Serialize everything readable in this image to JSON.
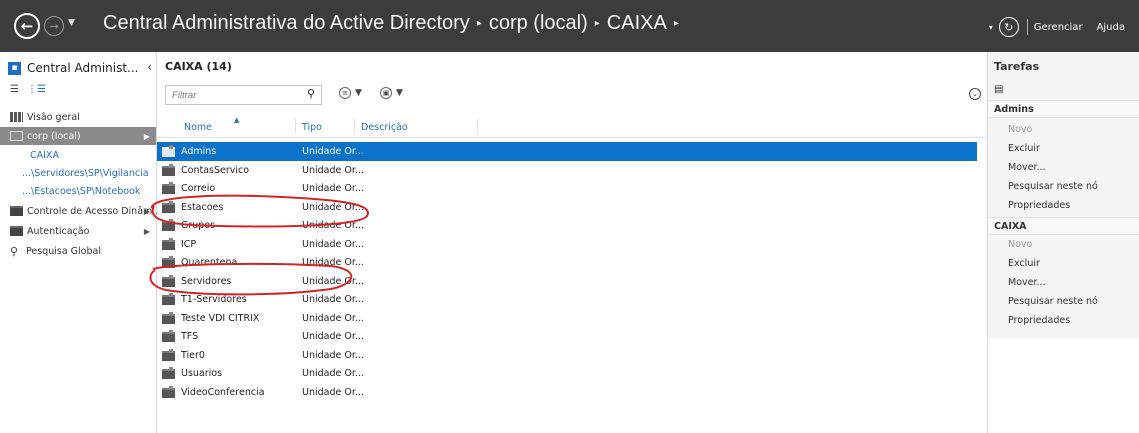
{
  "topbar": {
    "breadcrumbs": [
      "Central Administrativa do Active Directory",
      "corp (local)",
      "CAIXA"
    ],
    "separator": "▸",
    "manage": "Gerenciar",
    "help": "Ajuda"
  },
  "leftnav": {
    "title": "Central Administ...",
    "items": {
      "overview": "Visão geral",
      "corp": "corp (local)",
      "caixa": "CAIXA",
      "vigilancia": "...\\Servidores\\SP\\Vigilancia",
      "notebook": "...\\Estacoes\\SP\\Notebook",
      "access_control": "Controle de Acesso Dinâm...",
      "auth": "Autenticação",
      "global_search": "Pesquisa Global"
    }
  },
  "center": {
    "title": "CAIXA  (14)",
    "filter_placeholder": "Filtrar",
    "columns": [
      "Nome",
      "Tipo",
      "Descrição"
    ],
    "rows": [
      {
        "name": "Admins",
        "type": "Unidade Or..."
      },
      {
        "name": "ContasServico",
        "type": "Unidade Or..."
      },
      {
        "name": "Correio",
        "type": "Unidade Or..."
      },
      {
        "name": "Estacoes",
        "type": "Unidade Or..."
      },
      {
        "name": "Grupos",
        "type": "Unidade Or..."
      },
      {
        "name": "ICP",
        "type": "Unidade Or..."
      },
      {
        "name": "Quarentena",
        "type": "Unidade Or..."
      },
      {
        "name": "Servidores",
        "type": "Unidade Or..."
      },
      {
        "name": "T1-Servidores",
        "type": "Unidade Or..."
      },
      {
        "name": "Teste VDI CITRIX",
        "type": "Unidade Or..."
      },
      {
        "name": "TFS",
        "type": "Unidade Or..."
      },
      {
        "name": "Tier0",
        "type": "Unidade Or..."
      },
      {
        "name": "Usuarios",
        "type": "Unidade Or..."
      },
      {
        "name": "VideoConferencia",
        "type": "Unidade Or..."
      }
    ]
  },
  "tasks": {
    "title": "Tarefas",
    "section1": "Admins",
    "section1_actions": [
      "Novo",
      "Excluir",
      "Mover...",
      "Pesquisar neste nó",
      "Propriedades"
    ],
    "section2": "CAIXA",
    "section2_actions": [
      "Novo",
      "Excluir",
      "Mover...",
      "Pesquisar neste nó",
      "Propriedades"
    ]
  },
  "colors": {
    "topbar": "#3c3c3c",
    "selection": "#0a72c8",
    "link": "#2a6fbe",
    "annotation": "#d42424"
  },
  "icons": [
    "back-icon",
    "forward-icon",
    "refresh-icon",
    "search-icon",
    "folder-icon",
    "clipboard-icon",
    "chevron-down-icon"
  ]
}
